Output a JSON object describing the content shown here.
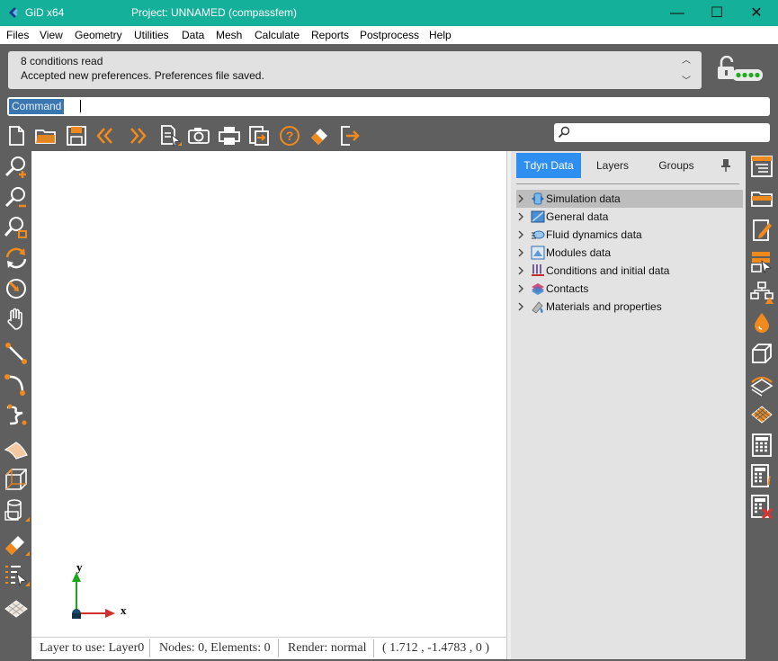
{
  "window": {
    "app_name": "GiD x64",
    "project_title": "Project: UNNAMED (compassfem)",
    "minimize_glyph": "—",
    "maximize_glyph": "☐",
    "close_glyph": "✕"
  },
  "menu": {
    "items": [
      "Files",
      "View",
      "Geometry",
      "Utilities",
      "Data",
      "Mesh",
      "Calculate",
      "Reports",
      "Postprocess",
      "Help"
    ]
  },
  "messages": {
    "lines": [
      "8 conditions read",
      "Accepted new preferences. Preferences file saved."
    ],
    "scroll_up": "︿",
    "scroll_down": "﹀"
  },
  "command": {
    "label": "Command",
    "value": ""
  },
  "search": {
    "placeholder": ""
  },
  "toolbar": {
    "icons": [
      "new-file-icon",
      "open-folder-icon",
      "save-icon",
      "undo-icon",
      "redo-icon",
      "document-select-icon",
      "camera-icon",
      "print-icon",
      "export-icon",
      "help-icon",
      "eraser-icon",
      "exit-icon"
    ]
  },
  "left_toolbar": {
    "icons": [
      "zoom-in-icon",
      "zoom-out-icon",
      "zoom-frame-icon",
      "rotate-icon",
      "rotate-center-icon",
      "pan-hand-icon",
      "line-icon",
      "arc-icon",
      "nurbs-line-icon",
      "surface-icon",
      "volume-icon",
      "cylinder-icon",
      "delete-icon",
      "list-select-icon",
      "render-icon"
    ]
  },
  "canvas": {
    "axis_x_label": "x",
    "axis_y_label": "y"
  },
  "status": {
    "layer": "Layer to use: Layer0",
    "counts": "Nodes: 0, Elements: 0",
    "render": "Render: normal",
    "coords": "( 1.712  , -1.4783 ,  0 )"
  },
  "panel": {
    "tabs": [
      "Tdyn Data",
      "Layers",
      "Groups"
    ],
    "active_tab": "Tdyn Data",
    "tree": [
      {
        "label": "Simulation data",
        "icon": "simulation-icon",
        "selected": true
      },
      {
        "label": "General data",
        "icon": "general-data-icon",
        "selected": false
      },
      {
        "label": "Fluid dynamics data",
        "icon": "fluid-dynamics-icon",
        "selected": false
      },
      {
        "label": "Modules data",
        "icon": "modules-icon",
        "selected": false
      },
      {
        "label": "Conditions and initial data",
        "icon": "conditions-icon",
        "selected": false
      },
      {
        "label": "Contacts",
        "icon": "contacts-icon",
        "selected": false
      },
      {
        "label": "Materials and properties",
        "icon": "materials-icon",
        "selected": false
      }
    ]
  },
  "right_toolbar": {
    "icons": [
      "data-tree-icon",
      "folder-icon",
      "edit-icon",
      "selection-icon",
      "hierarchy-icon",
      "drop-icon",
      "box-icon",
      "layers-icon",
      "mesh-surface-icon",
      "calculator-icon",
      "calculator-info-icon",
      "calculator-cancel-icon"
    ]
  },
  "colors": {
    "titlebar": "#14b09a",
    "accent_orange": "#f08a1c",
    "active_tab": "#2e8ff0",
    "toolbar_bg": "#5f5f5f"
  }
}
